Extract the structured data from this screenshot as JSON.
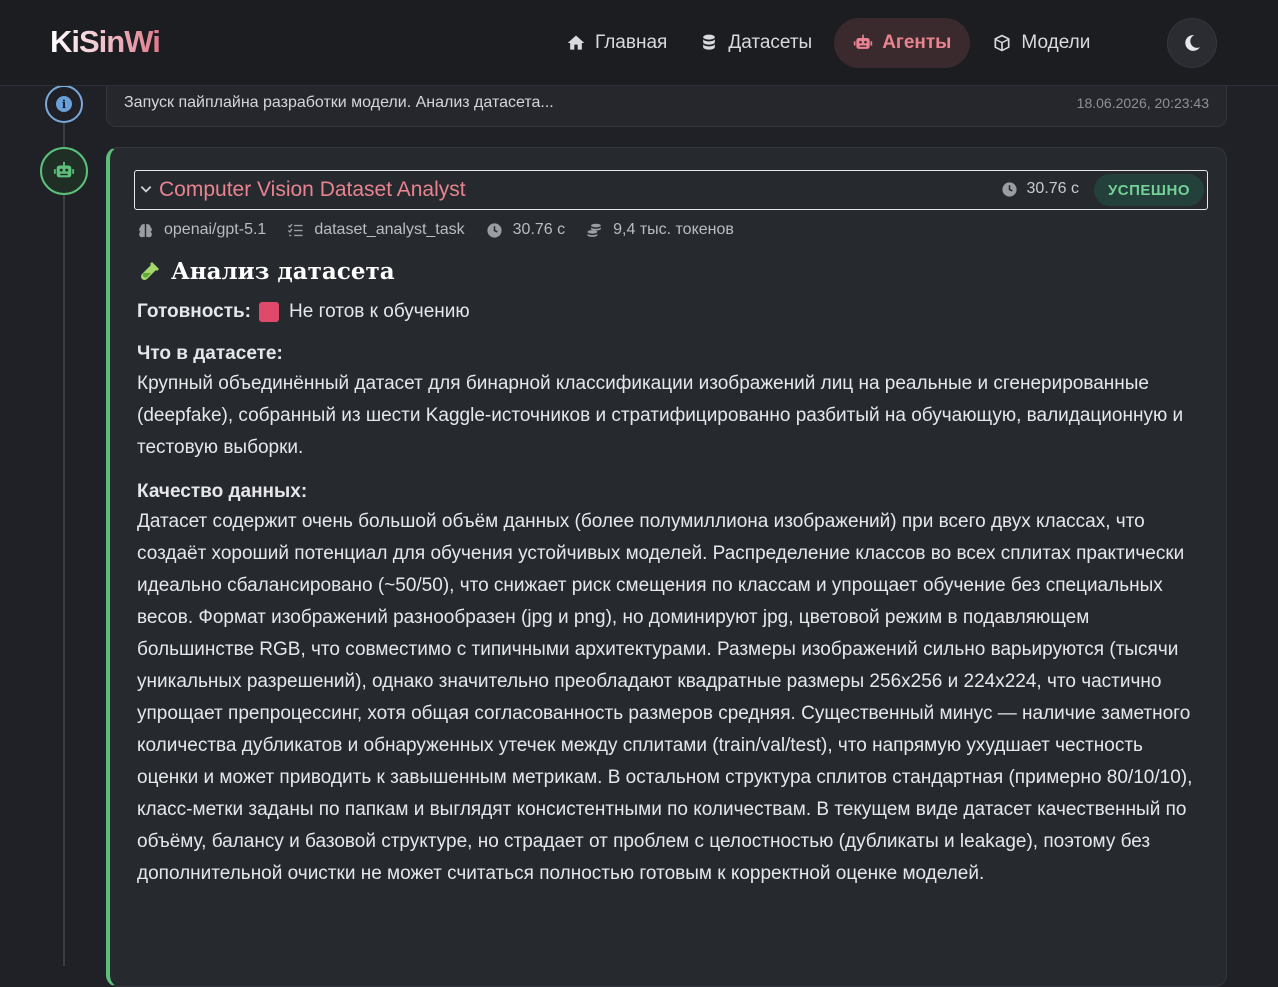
{
  "app": {
    "logo": "KiSinWi"
  },
  "nav": {
    "items": [
      {
        "label": "Главная",
        "icon": "home-icon"
      },
      {
        "label": "Датасеты",
        "icon": "database-icon"
      },
      {
        "label": "Агенты",
        "icon": "robot-icon",
        "active": true
      },
      {
        "label": "Модели",
        "icon": "cube-icon"
      }
    ],
    "theme_toggle_icon": "moon-icon"
  },
  "events": {
    "info": {
      "text": "Запуск пайплайна разработки модели. Анализ датасета...",
      "time": "18.06.2026, 20:23:43"
    },
    "agent": {
      "name": "Computer Vision Dataset Analyst",
      "duration": "30.76 с",
      "status": "УСПЕШНО",
      "meta": {
        "model": "openai/gpt-5.1",
        "task": "dataset_analyst_task",
        "time": "30.76 с",
        "tokens": "9,4 тыс. токенов"
      },
      "report": {
        "title": "Анализ датасета",
        "readiness_label": "Готовность:",
        "readiness_value": "Не готов к обучению",
        "section1_title": "Что в датасете:",
        "section1_text": "Крупный объединённый датасет для бинарной классификации изображений лиц на реальные и сгенерированные (deepfake), собранный из шести Kaggle-источников и стратифицированно разбитый на обучающую, валидационную и тестовую выборки.",
        "section2_title": "Качество данных:",
        "section2_text": "Датасет содержит очень большой объём данных (более полумиллиона изображений) при всего двух классах, что создаёт хороший потенциал для обучения устойчивых моделей. Распределение классов во всех сплитах практически идеально сбалансировано (~50/50), что снижает риск смещения по классам и упрощает обучение без специальных весов. Формат изображений разнообразен (jpg и png), но доминируют jpg, цветовой режим в подавляющем большинстве RGB, что совместимо с типичными архитектурами. Размеры изображений сильно варьируются (тысячи уникальных разрешений), однако значительно преобладают квадратные размеры 256x256 и 224x224, что частично упрощает препроцессинг, хотя общая согласованность размеров средняя. Существенный минус — наличие заметного количества дубликатов и обнаруженных утечек между сплитами (train/val/test), что напрямую ухудшает честность оценки и может приводить к завышенным метрикам. В остальном структура сплитов стандартная (примерно 80/10/10), класс-метки заданы по папкам и выглядят консистентными по количествам. В текущем виде датасет качественный по объёму, балансу и базовой структуре, но страдает от проблем с целостностью (дубликаты и leakage), поэтому без дополнительной очистки не может считаться полностью готовым к корректной оценке моделей."
      }
    }
  },
  "colors": {
    "accent": "#e8838f",
    "success": "#5cbf7a",
    "info": "#7aa8d8",
    "not_ready": "#e04a6a"
  }
}
